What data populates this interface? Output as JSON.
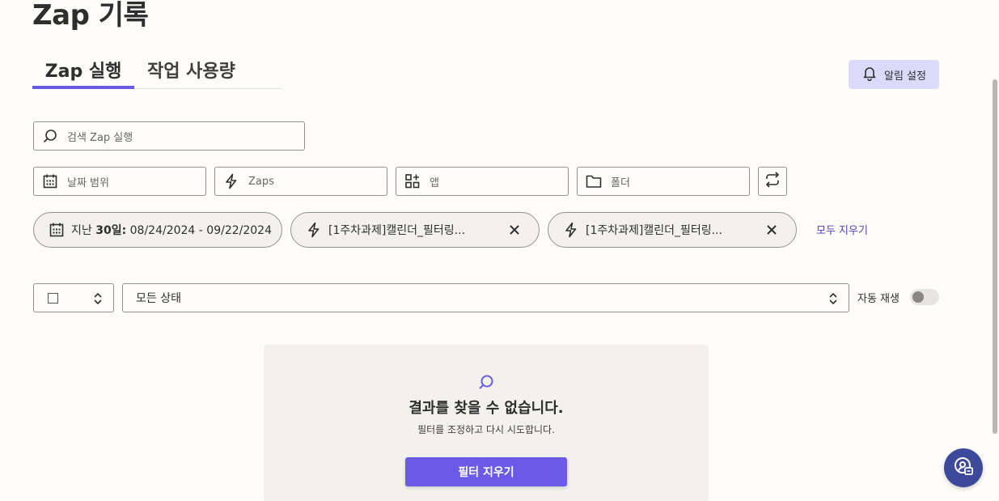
{
  "page": {
    "title": "Zap 기록"
  },
  "tabs": [
    {
      "label": "Zap 실행",
      "active": true
    },
    {
      "label": "작업 사용량",
      "active": false
    }
  ],
  "alert_button": {
    "label": "알림 설정",
    "icon": "bell-icon"
  },
  "search": {
    "placeholder": "검색 Zap 실행",
    "value": ""
  },
  "filters": {
    "date_range": {
      "placeholder": "날짜 범위",
      "icon": "calendar-icon"
    },
    "zaps": {
      "placeholder": "Zaps",
      "icon": "lightning-icon"
    },
    "apps": {
      "placeholder": "앱",
      "icon": "apps-icon"
    },
    "folders": {
      "placeholder": "폴더",
      "icon": "folder-icon"
    },
    "refresh_icon": "refresh-icon"
  },
  "active_filters": {
    "date_chip": {
      "prefix": "지난 ",
      "bold": "30일:",
      "range": " 08/24/2024 - 09/22/2024"
    },
    "zap_chips": [
      {
        "label": "[1주차과제]캘린더_필터링..."
      },
      {
        "label": "[1주차과제]캘린더_필터링..."
      }
    ],
    "clear_all": "모두 지우기"
  },
  "status_select": {
    "value": "모든 상태"
  },
  "autoplay": {
    "label": "자동 재생",
    "enabled": false
  },
  "empty_state": {
    "heading": "결과를 찾을 수 없습니다.",
    "subtext": "필터를 조정하고 다시 시도합니다.",
    "button": "필터 지우기"
  },
  "colors": {
    "accent": "#695be8",
    "accent_light": "#dcdafa",
    "link": "#503ebd",
    "help_button": "#3d4a9c"
  }
}
